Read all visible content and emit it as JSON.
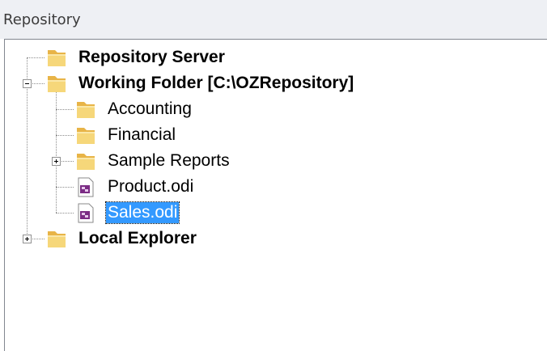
{
  "panel": {
    "title": "Repository"
  },
  "tree": {
    "nodes": [
      {
        "label": "Repository Server",
        "icon": "folder-icon"
      },
      {
        "label": "Working Folder [C:\\OZRepository]",
        "icon": "folder-icon",
        "expanded": true
      },
      {
        "label": "Accounting",
        "icon": "folder-icon"
      },
      {
        "label": "Financial",
        "icon": "folder-icon"
      },
      {
        "label": "Sample Reports",
        "icon": "folder-icon",
        "expanded": false
      },
      {
        "label": "Product.odi",
        "icon": "odi-file-icon"
      },
      {
        "label": "Sales.odi",
        "icon": "odi-file-icon",
        "selected": true
      },
      {
        "label": "Local Explorer",
        "icon": "folder-icon",
        "expanded": false
      }
    ]
  },
  "colors": {
    "selection": "#3399ff",
    "folder": "#f0c860",
    "odi_icon": "#7b2c84"
  }
}
